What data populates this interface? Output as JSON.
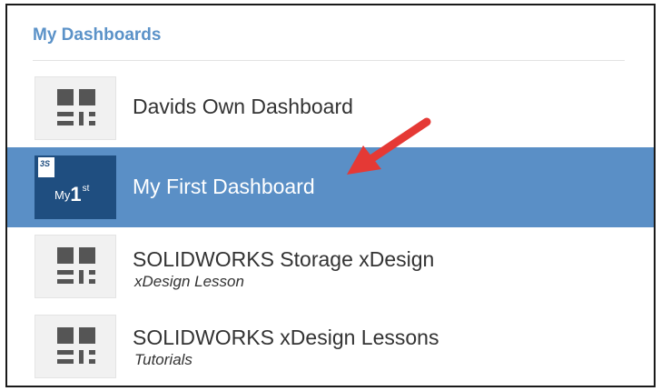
{
  "header": {
    "title": "My Dashboards"
  },
  "dashboards": [
    {
      "title": "Davids Own Dashboard",
      "subtitle": "",
      "icon": "dashboard-grid-icon",
      "selected": false
    },
    {
      "title": "My First Dashboard",
      "subtitle": "",
      "icon": "my-first-thumbnail",
      "selected": true,
      "thumb": {
        "badge": "3S",
        "prefix": "My",
        "number": "1",
        "suffix": "st"
      }
    },
    {
      "title": "SOLIDWORKS Storage xDesign",
      "subtitle": "xDesign Lesson",
      "icon": "dashboard-grid-icon",
      "selected": false
    },
    {
      "title": "SOLIDWORKS xDesign Lessons",
      "subtitle": "Tutorials",
      "icon": "dashboard-grid-icon",
      "selected": false
    }
  ],
  "colors": {
    "accent": "#5b92c8",
    "selected_row": "#5a8fc6",
    "thumb_dark": "#1f4e80",
    "arrow": "#e53935"
  }
}
